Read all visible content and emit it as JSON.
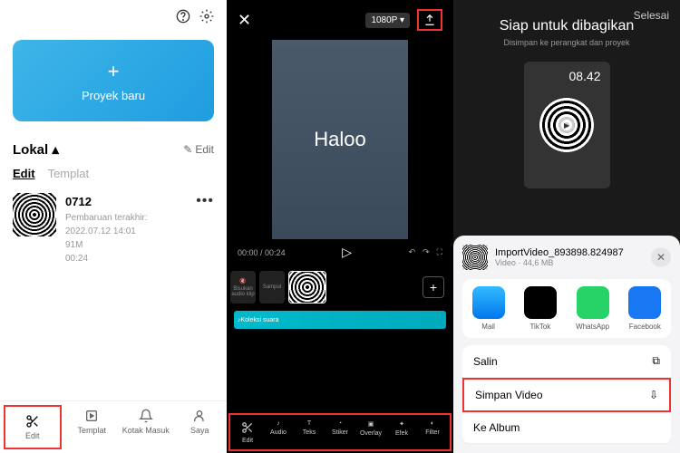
{
  "panel1": {
    "new_project": "Proyek baru",
    "local": "Lokal",
    "edit_link": "Edit",
    "tabs": {
      "edit": "Edit",
      "template": "Templat"
    },
    "project": {
      "title": "0712",
      "updated": "Pembaruan terakhir: 2022.07.12 14:01",
      "size": "91M",
      "duration": "00:24"
    },
    "nav": {
      "edit": "Edit",
      "templat": "Templat",
      "kotak": "Kotak Masuk",
      "saya": "Saya"
    }
  },
  "panel2": {
    "resolution": "1080P",
    "overlay_text": "Haloo",
    "time_current": "00:00",
    "time_total": "00:24",
    "timeline": {
      "mute": "Bisukan audio klip",
      "cover": "Sampul",
      "audio_label": "Koleksi suara"
    },
    "tools": {
      "edit": "Edit",
      "audio": "Audio",
      "teks": "Teks",
      "stiker": "Stiker",
      "overlay": "Overlay",
      "efek": "Efek",
      "filter": "Filter"
    }
  },
  "panel3": {
    "done": "Selesai",
    "title": "Siap untuk dibagikan",
    "subtitle": "Disimpan ke perangkat dan proyek",
    "preview_time": "08.42",
    "sheet": {
      "filename": "ImportVideo_893898.824987",
      "filemeta": "Video · 44,6 MB",
      "apps": {
        "mail": "Mail",
        "tiktok": "TikTok",
        "whatsapp": "WhatsApp",
        "facebook": "Facebook"
      },
      "actions": {
        "salin": "Salin",
        "simpan": "Simpan Video",
        "album": "Ke Album"
      }
    }
  }
}
